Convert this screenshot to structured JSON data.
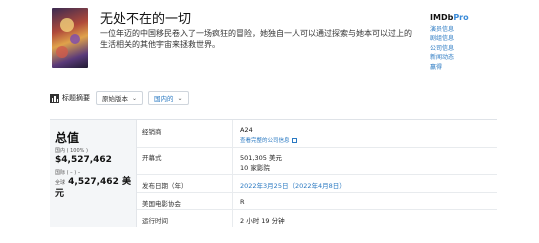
{
  "movie": {
    "title": "无处不在的一切",
    "description": "一位年迈的中国移民卷入了一场疯狂的冒险，她独自一人可以通过探索与她本可以过上的生活相关的其他宇宙来拯救世界。"
  },
  "imdbpro": {
    "brand_main": "IMDb",
    "brand_pro": "Pro",
    "links": [
      "演员信息",
      "剧组信息",
      "公司信息",
      "新闻动态",
      "赢得"
    ]
  },
  "controls": {
    "summary_label": "标题摘要",
    "release_dropdown": "原始版本",
    "region_dropdown": "国内的"
  },
  "totals": {
    "title": "总值",
    "domestic_label": "国内 ( 100% )",
    "domestic_value": "$4,527,462",
    "international_label": "国际 ( – )",
    "international_value": "–",
    "worldwide_label": "全球",
    "worldwide_value": "4,527,462 美元"
  },
  "details": {
    "distributor_label": "经销商",
    "distributor_value": "A24",
    "distributor_link": "查看完整的公司信息",
    "opening_label": "开幕式",
    "opening_value": "501,305 美元",
    "opening_sub": "10 家影院",
    "release_label": "发布日期（年）",
    "release_value": "2022年3月25日（2022年4月8日）",
    "mpaa_label": "美国电影协会",
    "mpaa_value": "R",
    "runtime_label": "运行时间",
    "runtime_value": "2 小时 19 分钟"
  }
}
